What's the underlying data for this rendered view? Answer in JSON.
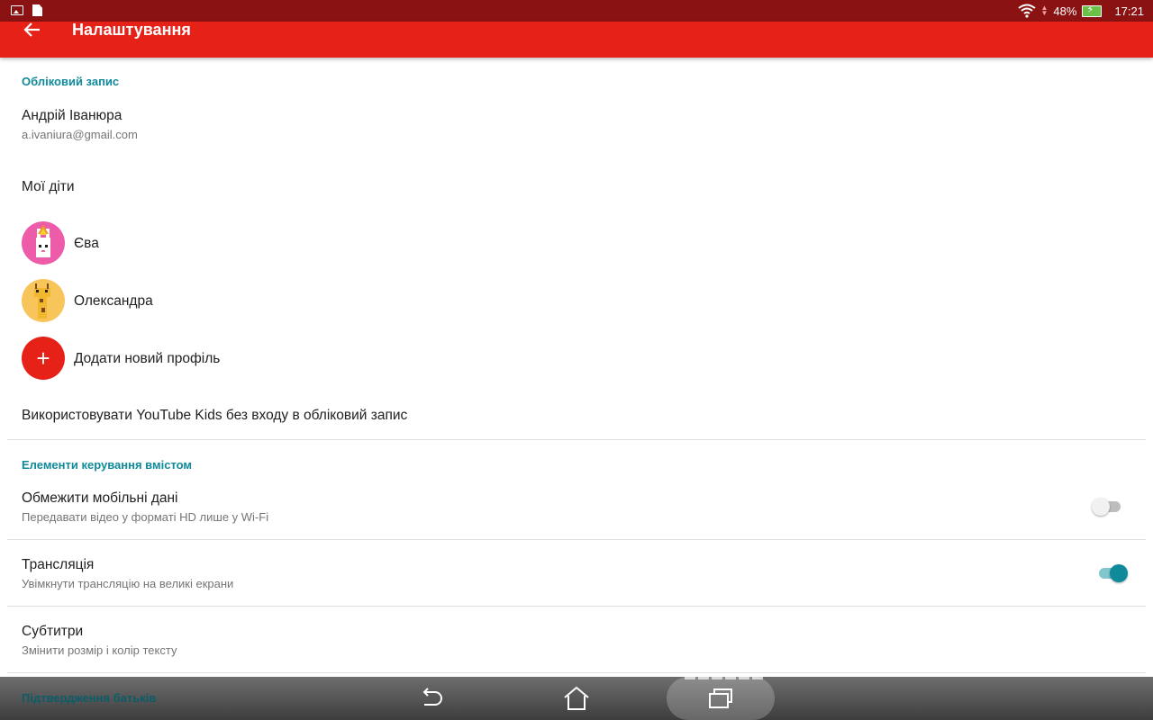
{
  "status_bar": {
    "battery": "48%",
    "time": "17:21",
    "icons": [
      "image-icon",
      "document-icon",
      "wifi-icon",
      "data-arrows-icon",
      "battery-charging-icon"
    ]
  },
  "toolbar": {
    "title": "Налаштування",
    "back_icon": "arrow-left-icon"
  },
  "account": {
    "header": "Обліковий запис",
    "name": "Андрій Іванюра",
    "email": "a.ivaniura@gmail.com"
  },
  "children": {
    "header": "Мої діти",
    "items": [
      {
        "name": "Єва",
        "avatar_color": "#ec5ca8"
      },
      {
        "name": "Олександра",
        "avatar_color": "#f7c55a"
      }
    ],
    "add_label": "Додати новий профіль"
  },
  "no_login_label": "Використовувати YouTube Kids без входу в обліковий запис",
  "content_controls": {
    "header": "Елементи керування вмістом",
    "items": [
      {
        "title": "Обмежити мобільні дані",
        "subtitle": "Передавати відео у форматі HD лише у Wi-Fi",
        "enabled": false
      },
      {
        "title": "Трансляція",
        "subtitle": "Увімкнути трансляцію на великі екрани",
        "enabled": true
      },
      {
        "title": "Субтитри",
        "subtitle": "Змінити розмір і колір тексту"
      }
    ]
  },
  "parental": {
    "header": "Підтвердження батьків"
  },
  "colors": {
    "toolbar": "#e62117",
    "status_bar": "#8a1212",
    "accent": "#0e8a9a"
  },
  "nav_icons": [
    "back-nav-icon",
    "home-nav-icon",
    "recents-nav-icon"
  ]
}
